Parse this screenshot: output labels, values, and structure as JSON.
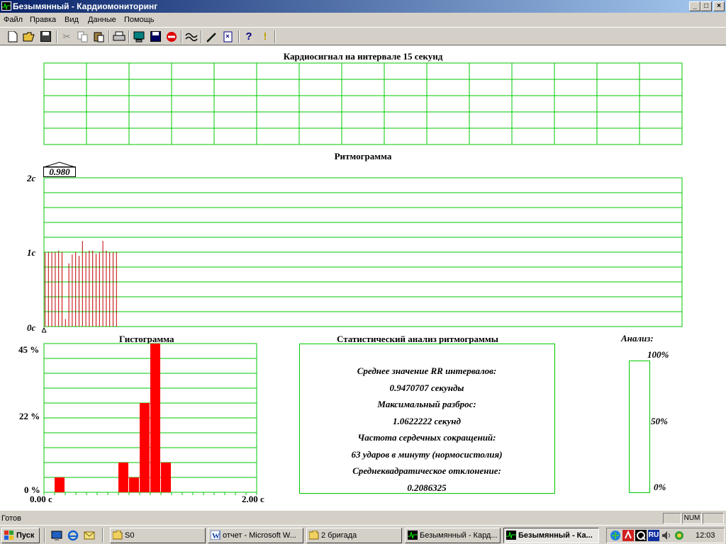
{
  "window": {
    "title": "Безымянный - Кардиомониторинг"
  },
  "menu": [
    "Файл",
    "Правка",
    "Вид",
    "Данные",
    "Помощь"
  ],
  "toolbar_icons": [
    "new-icon",
    "open-icon",
    "save-icon",
    "cut-icon",
    "copy-icon",
    "paste-icon",
    "print-icon",
    "monitor-icon",
    "disk-icon",
    "stop-icon",
    "wave-icon",
    "pen-icon",
    "document-icon",
    "help-icon",
    "exclamation-icon"
  ],
  "cardio": {
    "title": "Кардиосигнал на интервале 15 секунд"
  },
  "rhythm": {
    "title": "Ритмограмма",
    "cursor_value": "0.980",
    "y_labels": [
      "2c",
      "1c",
      "0c"
    ]
  },
  "histogram": {
    "title": "Гистограмма",
    "y_labels": [
      "45 %",
      "22 %",
      "0 %"
    ],
    "x_labels": [
      "0.00 c",
      "2.00 c"
    ]
  },
  "stats": {
    "title": "Статистический анализ ритмограммы",
    "lines": [
      "Среднее значение RR интервалов:",
      "0.9470707 секунды",
      "Максимальный разброс:",
      "1.0622222 секунд",
      "Частота сердечных сокращений:",
      "63 ударов в минуту (нормосистолия)",
      "Среднеквадратическое отклонение:",
      "0.2086325"
    ]
  },
  "analysis": {
    "title": "Анализ:",
    "labels": [
      "100%",
      "50%",
      "0%"
    ],
    "level": 0
  },
  "status": {
    "text": "Готов",
    "num": "NUM"
  },
  "taskbar": {
    "start": "Пуск",
    "items": [
      "S0",
      "отчет - Microsoft W...",
      "2 бригада",
      "Безымянный - Кард...",
      "Безымянный - Ка..."
    ],
    "lang": "RU",
    "clock": "12:03"
  },
  "chart_data": [
    {
      "type": "bar",
      "title": "Ритмограмма",
      "ylabel": "",
      "ylim": [
        0,
        2
      ],
      "values": [
        1.0,
        1.0,
        1.0,
        1.0,
        1.02,
        1.0,
        0.1,
        0.85,
        0.97,
        1.0,
        0.95,
        1.15,
        1.0,
        1.02,
        1.02,
        0.98,
        1.0,
        1.15,
        1.02,
        1.0,
        1.0,
        1.0
      ]
    },
    {
      "type": "bar",
      "title": "Гистограмма",
      "xlim": [
        0,
        2
      ],
      "ylim": [
        0,
        45
      ],
      "bin_width": 0.1,
      "x": [
        0.1,
        0.7,
        0.8,
        0.9,
        1.0,
        1.1
      ],
      "values": [
        4.5,
        9,
        4.5,
        27,
        45,
        9
      ]
    }
  ]
}
